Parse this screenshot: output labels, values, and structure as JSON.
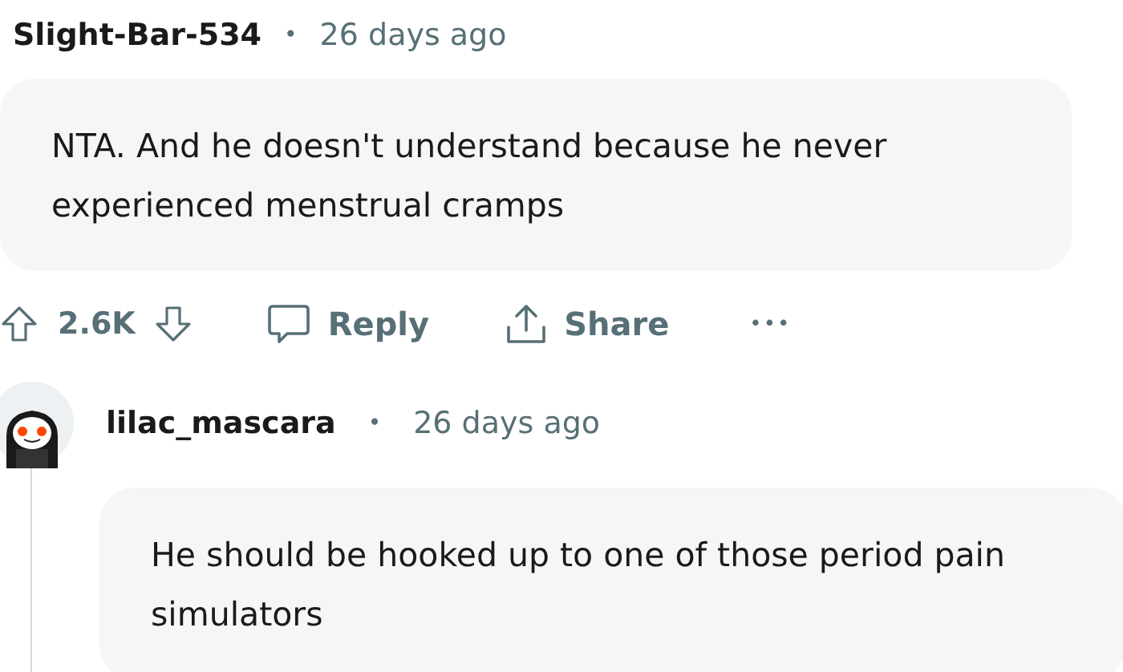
{
  "comments": [
    {
      "author": "Slight-Bar-534",
      "separator": "•",
      "time": "26 days ago",
      "body": "NTA. And he doesn't understand because he never experienced menstrual cramps",
      "has_avatar": false,
      "actions": {
        "votes": "2.6K",
        "reply": "Reply",
        "share": "Share",
        "more": "•••"
      },
      "children": [
        {
          "author": "lilac_mascara",
          "separator": "•",
          "time": "26 days ago",
          "body": "He should be hooked up to one of those period pain simulators",
          "has_avatar": true
        }
      ]
    }
  ]
}
